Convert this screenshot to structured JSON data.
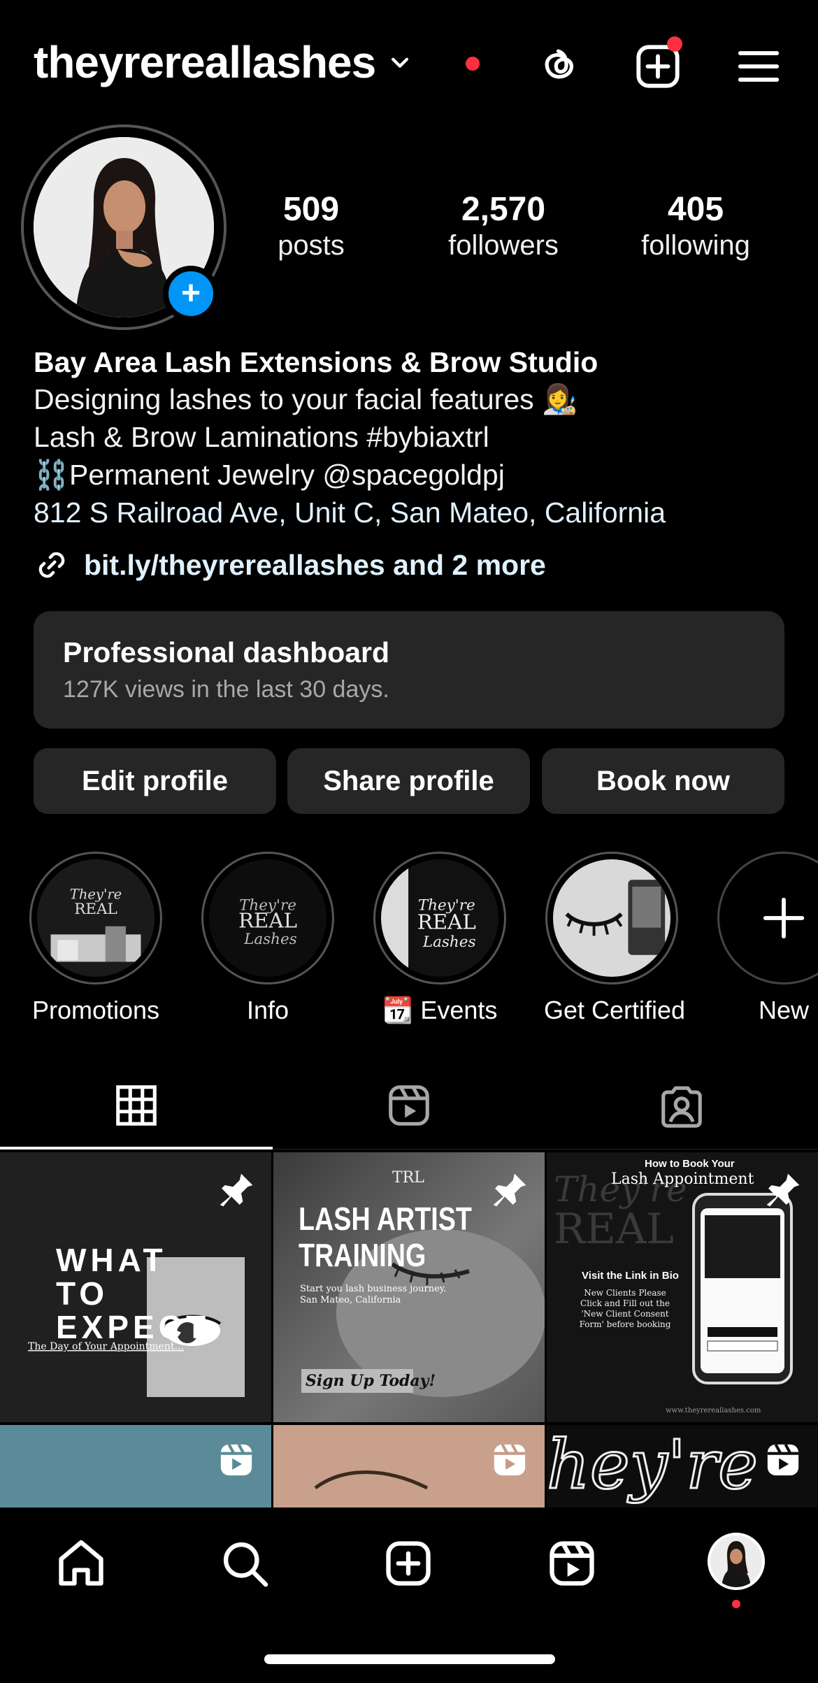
{
  "header": {
    "username": "theyrereallashes"
  },
  "profile": {
    "stats": [
      {
        "value": "509",
        "label": "posts"
      },
      {
        "value": "2,570",
        "label": "followers"
      },
      {
        "value": "405",
        "label": "following"
      }
    ],
    "bio": {
      "name": "Bay Area Lash Extensions & Brow Studio",
      "line1": "Designing lashes to your facial features 👩‍🎨",
      "line2": "Lash & Brow Laminations #bybiaxtrl",
      "line3": "⛓️Permanent Jewelry @spacegoldpj",
      "address": "812 S Railroad Ave, Unit C, San Mateo, California",
      "link": "bit.ly/theyrereallashes and 2 more"
    }
  },
  "dashboard": {
    "title": "Professional dashboard",
    "subtitle": "127K views in the last 30 days."
  },
  "buttons": {
    "edit": "Edit profile",
    "share": "Share profile",
    "book": "Book now"
  },
  "highlights": [
    {
      "label": "Promotions"
    },
    {
      "label": "Info"
    },
    {
      "label": "📆 Events"
    },
    {
      "label": "Get Certified"
    },
    {
      "label": "New"
    }
  ],
  "posts": {
    "p1": {
      "title": "WHAT TO EXPECT",
      "caption": "The Day of Your Appointment..."
    },
    "p2": {
      "brand": "TRL",
      "title1": "LASH ARTIST",
      "title2": "TRAINING",
      "sub": "Start you lash business journey. San Mateo, California",
      "cta": "Sign Up Today!"
    },
    "p3": {
      "head1": "How to Book Your",
      "head2": "Lash Appointment",
      "cta": "Visit the Link in Bio",
      "body": "New Clients Please Click and Fill out the 'New Client Consent Form' before booking",
      "url": "www.theyrereallashes.com"
    }
  },
  "colors": {
    "accent_blue": "#0095f6",
    "notif_red": "#ff3040",
    "surface": "#262626"
  }
}
